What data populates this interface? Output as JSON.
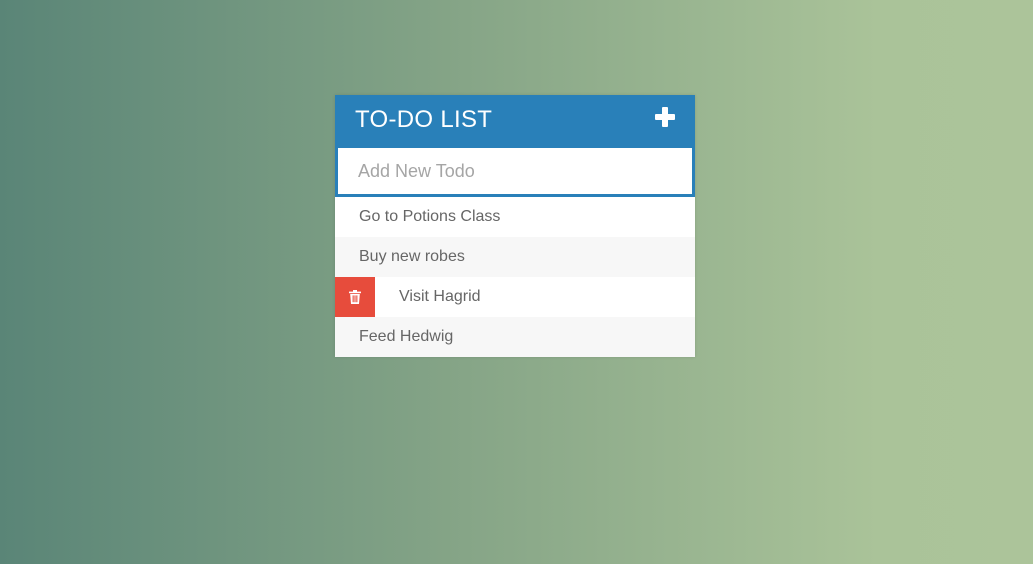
{
  "header": {
    "title": "TO-DO LIST",
    "add_icon": "plus-icon"
  },
  "new_todo": {
    "placeholder": "Add New Todo",
    "value": ""
  },
  "todos": [
    {
      "text": "Go to Potions Class",
      "hovered": false
    },
    {
      "text": "Buy new robes",
      "hovered": false
    },
    {
      "text": "Visit Hagrid",
      "hovered": true
    },
    {
      "text": "Feed Hedwig",
      "hovered": false
    }
  ],
  "delete_icon": "trash-icon",
  "colors": {
    "header": "#2980b9",
    "delete": "#e74c3c",
    "text": "#666666",
    "alt_row": "#f7f7f7"
  }
}
